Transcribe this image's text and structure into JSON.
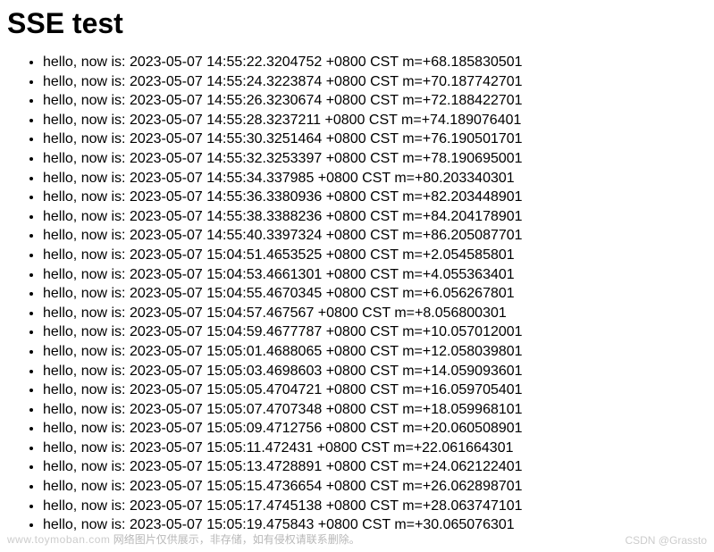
{
  "title": "SSE test",
  "entries": [
    "hello, now is: 2023-05-07 14:55:22.3204752 +0800 CST m=+68.185830501",
    "hello, now is: 2023-05-07 14:55:24.3223874 +0800 CST m=+70.187742701",
    "hello, now is: 2023-05-07 14:55:26.3230674 +0800 CST m=+72.188422701",
    "hello, now is: 2023-05-07 14:55:28.3237211 +0800 CST m=+74.189076401",
    "hello, now is: 2023-05-07 14:55:30.3251464 +0800 CST m=+76.190501701",
    "hello, now is: 2023-05-07 14:55:32.3253397 +0800 CST m=+78.190695001",
    "hello, now is: 2023-05-07 14:55:34.337985 +0800 CST m=+80.203340301",
    "hello, now is: 2023-05-07 14:55:36.3380936 +0800 CST m=+82.203448901",
    "hello, now is: 2023-05-07 14:55:38.3388236 +0800 CST m=+84.204178901",
    "hello, now is: 2023-05-07 14:55:40.3397324 +0800 CST m=+86.205087701",
    "hello, now is: 2023-05-07 15:04:51.4653525 +0800 CST m=+2.054585801",
    "hello, now is: 2023-05-07 15:04:53.4661301 +0800 CST m=+4.055363401",
    "hello, now is: 2023-05-07 15:04:55.4670345 +0800 CST m=+6.056267801",
    "hello, now is: 2023-05-07 15:04:57.467567 +0800 CST m=+8.056800301",
    "hello, now is: 2023-05-07 15:04:59.4677787 +0800 CST m=+10.057012001",
    "hello, now is: 2023-05-07 15:05:01.4688065 +0800 CST m=+12.058039801",
    "hello, now is: 2023-05-07 15:05:03.4698603 +0800 CST m=+14.059093601",
    "hello, now is: 2023-05-07 15:05:05.4704721 +0800 CST m=+16.059705401",
    "hello, now is: 2023-05-07 15:05:07.4707348 +0800 CST m=+18.059968101",
    "hello, now is: 2023-05-07 15:05:09.4712756 +0800 CST m=+20.060508901",
    "hello, now is: 2023-05-07 15:05:11.472431 +0800 CST m=+22.061664301",
    "hello, now is: 2023-05-07 15:05:13.4728891 +0800 CST m=+24.062122401",
    "hello, now is: 2023-05-07 15:05:15.4736654 +0800 CST m=+26.062898701",
    "hello, now is: 2023-05-07 15:05:17.4745138 +0800 CST m=+28.063747101",
    "hello, now is: 2023-05-07 15:05:19.475843 +0800 CST m=+30.065076301"
  ],
  "footer": {
    "left_domain": "www.toymoban.com",
    "left_cn": "网络图片仅供展示，非存储，如有侵权请联系删除。",
    "right": "CSDN @Grassto"
  }
}
